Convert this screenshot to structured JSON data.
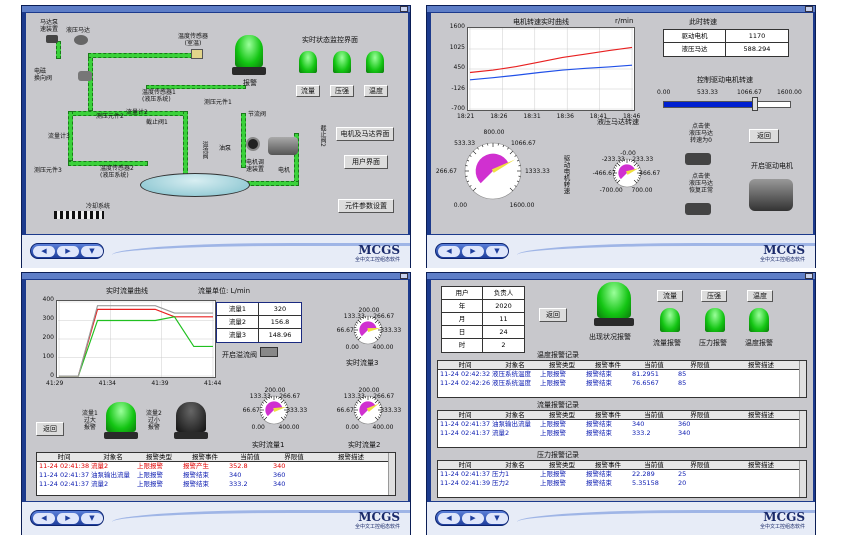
{
  "common": {
    "brand": "MCGS",
    "brand_sub": "全中文工控组态软件",
    "nav": [
      "◀",
      "▶",
      "▼"
    ]
  },
  "p1": {
    "labels": {
      "motor_pump": "马达泵\n速装置",
      "hydraulic_pump": "液压马达",
      "temp_sensor": "温度传感器\n(室温)",
      "alarm": "报警",
      "realtime_title": "实时状态监控界面",
      "flow": "流量",
      "pressure": "压强",
      "temperature": "温度",
      "solenoid": "电磁\n换向阀",
      "temp_sensor1": "温度传感器1\n(液压系统)",
      "pressure_elem1": "测压元件1",
      "flow_meter2": "流量计2",
      "throttle1": "截止阀1",
      "hydro_elem2": "测压元件2",
      "flow_meter3": "流量计3",
      "pressure_elem3": "测压元件3",
      "temp_sensor2": "温度传感器2\n(液压系统)",
      "hydro_valve": "溢流阀",
      "motor_unit": "电机调\n速装置",
      "motor": "电机",
      "cool_system": "冷却系统",
      "throttle2": "截止阀2",
      "node": "节流阀",
      "oil_pump": "油泵"
    },
    "buttons": {
      "motor_hydro": "电机及马达界面",
      "user": "用户界面",
      "params": "元件参数设置"
    },
    "colors": {
      "pipe": "#3BD13B",
      "tank": "#9ACED8"
    }
  },
  "p2": {
    "chart_data": {
      "type": "line",
      "title": "电机转速实时曲线",
      "ylabel": "r/min",
      "x": [
        "18:21",
        "18:26",
        "18:31",
        "18:36",
        "18:41",
        "18:46"
      ],
      "ylim": [
        -700,
        1600
      ],
      "yticks": [
        "1600",
        "1025",
        "450",
        "-126",
        "-700"
      ],
      "series": [
        {
          "color": "#E82020",
          "values": [
            350,
            420,
            520,
            650,
            780,
            880,
            980,
            1070
          ]
        },
        {
          "color": "#2050E8",
          "values": [
            140,
            200,
            270,
            350,
            420,
            470,
            510,
            560
          ]
        }
      ]
    },
    "speed_title": "此时转速",
    "speed_table": [
      {
        "k": "驱动电机",
        "v": "1170"
      },
      {
        "k": "液压马达",
        "v": "588.294"
      }
    ],
    "slider_title": "控制驱动电机转速",
    "slider_ticks": [
      "0.00",
      "533.33",
      "1066.67",
      "1600.00"
    ],
    "slider_value": 1170,
    "slider_max": 1600,
    "gauge1_title": "驱动电机转速",
    "gauge1_ticks": [
      "800.00",
      "533.33",
      "1066.67",
      "266.67",
      "1333.33",
      "0.00",
      "1600.00"
    ],
    "gauge2_title": "液压马达转速",
    "gauge2_ticks": [
      "-0.00",
      "-233.33",
      "233.33",
      "-466.67",
      "466.67",
      "-700.00",
      "700.00"
    ],
    "motor_label1": "点击使\n液压马达\n转速为0",
    "motor_label2": "点击使\n液压马达\n恢复正常",
    "start_motor": "开启驱动电机",
    "back": "返回"
  },
  "p3": {
    "chart_data": {
      "type": "line",
      "title": "实时流量曲线",
      "x": [
        "41:29",
        "41:34",
        "41:39",
        "41:44"
      ],
      "ylim": [
        0,
        400
      ],
      "yticks": [
        "400",
        "300",
        "200",
        "100",
        "0"
      ],
      "series": [
        {
          "name": "流量1",
          "color": "#E82020",
          "values": [
            0,
            0,
            360,
            360,
            360,
            360,
            320,
            320,
            320
          ]
        },
        {
          "name": "流量2",
          "color": "#20C020",
          "values": [
            0,
            0,
            300,
            300,
            300,
            300,
            320,
            160,
            160
          ]
        },
        {
          "name": "流量3",
          "color": "#9A9A9A",
          "values": [
            0,
            0,
            380,
            380,
            380,
            380,
            340,
            340,
            340
          ]
        }
      ]
    },
    "unit": "流量单位: L/min",
    "flow_table": [
      {
        "k": "流量1",
        "v": "320"
      },
      {
        "k": "流量2",
        "v": "156.8"
      },
      {
        "k": "流量3",
        "v": "148.96"
      }
    ],
    "open_valve": "开启溢流阀",
    "gauge_ticks": [
      "200.00",
      "133.33",
      "266.67",
      "66.67",
      "333.33",
      "0.00",
      "400.00"
    ],
    "gauge3_title": "实时流量3",
    "gauge1_title": "实时流量1",
    "gauge2_title": "实时流量2",
    "lamp1": "流量1\n过大\n报警",
    "lamp2": "流量2\n过小\n报警",
    "back": "返回",
    "alarm_headers": [
      "时间",
      "对象名",
      "报警类型",
      "报警事件",
      "当前值",
      "界限值",
      "报警描述"
    ],
    "alarm_rows": [
      {
        "time": "11-24 02:41:38",
        "obj": "流量2",
        "type": "上限报警",
        "event": "报警产生",
        "val": "352.8",
        "lim": "340",
        "desc": "",
        "color": "#E00000"
      },
      {
        "time": "11-24 02:41:37",
        "obj": "油泵输出流量",
        "type": "上限报警",
        "event": "报警结束",
        "val": "340",
        "lim": "360",
        "desc": "",
        "color": "#0A1AB0"
      },
      {
        "time": "11-24 02:41:37",
        "obj": "流量2",
        "type": "上限报警",
        "event": "报警结束",
        "val": "333.2",
        "lim": "340",
        "desc": "",
        "color": "#0A1AB0"
      }
    ]
  },
  "p4": {
    "info": [
      {
        "k": "用户",
        "v": "负责人"
      },
      {
        "k": "年",
        "v": "2020"
      },
      {
        "k": "月",
        "v": "11"
      },
      {
        "k": "日",
        "v": "24"
      },
      {
        "k": "时",
        "v": "2"
      }
    ],
    "back": "返回",
    "big_lamp": "出现状况报警",
    "btns": [
      "流量",
      "压强",
      "温度"
    ],
    "lamps": [
      "流量报警",
      "压力报警",
      "温度报警"
    ],
    "temp_title": "温度报警记录",
    "flow_title": "流量报警记录",
    "press_title": "压力报警记录",
    "headers": [
      "时间",
      "对象名",
      "报警类型",
      "报警事件",
      "当前值",
      "界限值",
      "报警描述"
    ],
    "temp_rows": [
      {
        "time": "11-24 02:42:32",
        "obj": "液压系统温度",
        "type": "上限报警",
        "event": "报警结束",
        "val": "81.2951",
        "lim": "85"
      },
      {
        "time": "11-24 02:42:26",
        "obj": "液压系统温度",
        "type": "上限报警",
        "event": "报警结束",
        "val": "76.6567",
        "lim": "85"
      }
    ],
    "flow_rows": [
      {
        "time": "11-24 02:41:37",
        "obj": "油泵输出流量",
        "type": "上限报警",
        "event": "报警结束",
        "val": "340",
        "lim": "360"
      },
      {
        "time": "11-24 02:41:37",
        "obj": "流量2",
        "type": "上限报警",
        "event": "报警结束",
        "val": "333.2",
        "lim": "340"
      }
    ],
    "press_rows": [
      {
        "time": "11-24 02:41:37",
        "obj": "压力1",
        "type": "上限报警",
        "event": "报警结束",
        "val": "22.289",
        "lim": "25"
      },
      {
        "time": "11-24 02:41:39",
        "obj": "压力2",
        "type": "上限报警",
        "event": "报警结束",
        "val": "5.35158",
        "lim": "20"
      }
    ]
  }
}
